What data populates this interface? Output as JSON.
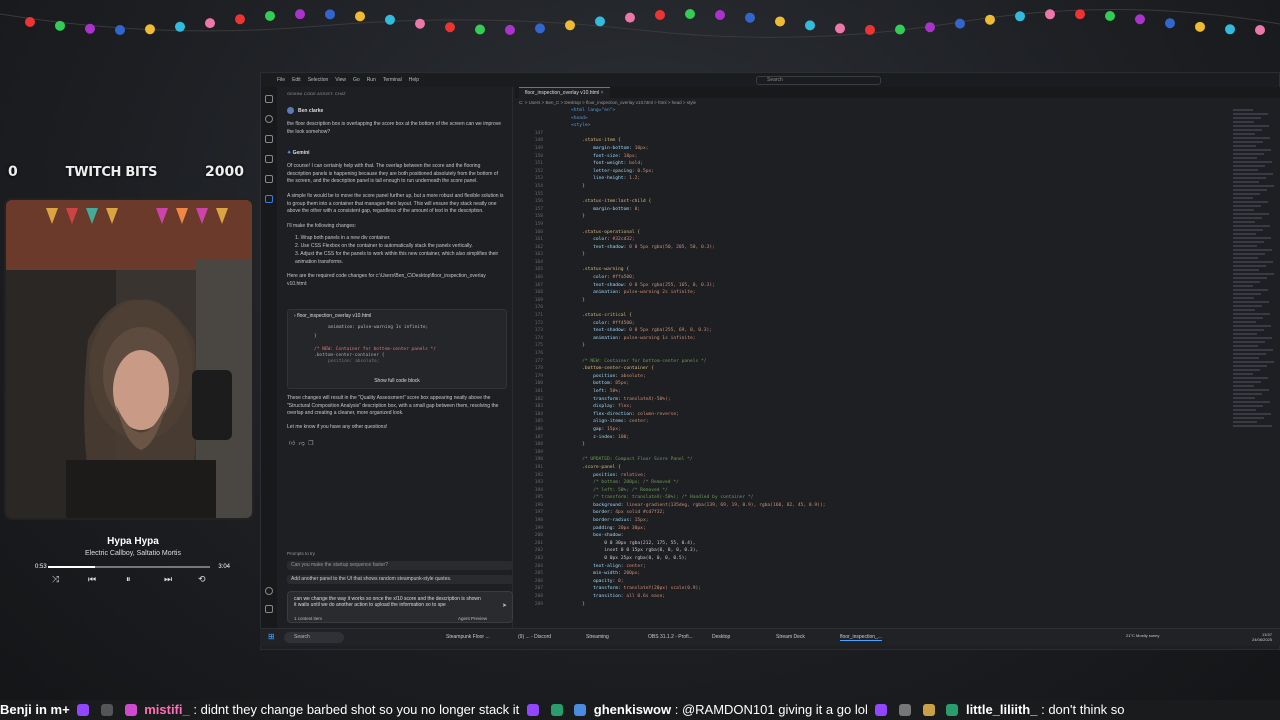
{
  "overlay": {
    "bits_left": "0",
    "bits_label": "TWITCH BITS",
    "bits_right": "2000"
  },
  "music": {
    "title": "Hypa Hypa",
    "artist": "Electric Callboy, Saltatio Mortis",
    "elapsed": "0:53",
    "duration": "3:04",
    "progress": 0.29
  },
  "menubar": {
    "items": [
      "File",
      "Edit",
      "Selection",
      "View",
      "Go",
      "Run",
      "Terminal",
      "Help"
    ],
    "search_placeholder": "Search"
  },
  "chat": {
    "header": "GEMINI CODE ASSIST: CHAT",
    "user_name": "Ben clarke",
    "user_message": "the floor description box is overlapping the score box at the bottom of the screen can we improve the look somehow?",
    "assistant_name": "Gemini",
    "p1": "Of course! I can certainly help with that. The overlap between the score and the flooring description panels is happening because they are both positioned absolutely from the bottom of the screen, and the description panel is tall enough to run underneath the score panel.",
    "p2": "A simple fix would be to move the score panel further up, but a more robust and flexible solution is to group them into a container that manages their layout. This will ensure they stack neatly one above the other with a consistent gap, regardless of the amount of text in the description.",
    "p3": "I'll make the following changes:",
    "steps": [
      "Wrap both panels in a new div container.",
      "Use CSS Flexbox on the container to automatically stack the panels vertically.",
      "Adjust the CSS for the panels to work within this new container, which also simplifies their animation transforms."
    ],
    "p4": "Here are the required code changes for c:\\Users\\Ben_C\\Desktop\\floor_inspection_overlay v10.html:",
    "code_file": "floor_inspection_overlay v10.html",
    "code_l1": "animation: pulse-warning 1s infinite;",
    "code_l2": "}",
    "code_l3": "/* NEW: Container for bottom-center panels */",
    "code_l4": ".bottom-center-container {",
    "code_l5": "position: absolute;",
    "show_full": "Show full code block",
    "p5": "These changes will result in the \"Quality Assessment\" score box appearing neatly above the \"Structural Composition Analysis\" description box, with a small gap between them, resolving the overlap and creating a cleaner, more organized look.",
    "p6": "Let me know if you have any other questions!",
    "prompts_label": "Prompts to try",
    "prompt1": "Can you make the startup sequence faster?",
    "prompt2": "Add another panel to the UI that shows random steampunk-style quotes.",
    "input_text": "can we change the way it works so once the x/10 score and the description is shown it waits until we do another action to upload the information so to spe",
    "context": "1 context item",
    "mode": "Agent   Preview"
  },
  "editor": {
    "tab": "floor_inspection_overlay v10.html",
    "breadcrumb": "C: > Users > Ben_C > Desktop > floor_inspection_overlay v10.html > html > head > style",
    "top_lines": [
      "<html lang=\"en\">",
      "<head>",
      "<style>"
    ],
    "lines": [
      {
        "n": "147",
        "t": ""
      },
      {
        "n": "148",
        "t": "    .status-item {"
      },
      {
        "n": "149",
        "t": "        margin-bottom: 10px;"
      },
      {
        "n": "150",
        "t": "        font-size: 18px;"
      },
      {
        "n": "151",
        "t": "        font-weight: bold;"
      },
      {
        "n": "152",
        "t": "        letter-spacing: 0.5px;"
      },
      {
        "n": "153",
        "t": "        line-height: 1.2;"
      },
      {
        "n": "154",
        "t": "    }"
      },
      {
        "n": "155",
        "t": ""
      },
      {
        "n": "156",
        "t": "    .status-item:last-child {"
      },
      {
        "n": "157",
        "t": "        margin-bottom: 0;"
      },
      {
        "n": "158",
        "t": "    }"
      },
      {
        "n": "159",
        "t": ""
      },
      {
        "n": "160",
        "t": "    .status-operational {"
      },
      {
        "n": "161",
        "t": "        color: #32cd32;"
      },
      {
        "n": "162",
        "t": "        text-shadow: 0 0 5px rgba(50, 205, 50, 0.3);"
      },
      {
        "n": "163",
        "t": "    }"
      },
      {
        "n": "164",
        "t": ""
      },
      {
        "n": "165",
        "t": "    .status-warning {"
      },
      {
        "n": "166",
        "t": "        color: #ffa500;"
      },
      {
        "n": "167",
        "t": "        text-shadow: 0 0 5px rgba(255, 165, 0, 0.3);"
      },
      {
        "n": "168",
        "t": "        animation: pulse-warning 2s infinite;"
      },
      {
        "n": "169",
        "t": "    }"
      },
      {
        "n": "170",
        "t": ""
      },
      {
        "n": "171",
        "t": "    .status-critical {"
      },
      {
        "n": "172",
        "t": "        color: #ff4500;"
      },
      {
        "n": "173",
        "t": "        text-shadow: 0 0 5px rgba(255, 69, 0, 0.3);"
      },
      {
        "n": "174",
        "t": "        animation: pulse-warning 1s infinite;"
      },
      {
        "n": "175",
        "t": "    }"
      },
      {
        "n": "176",
        "t": ""
      },
      {
        "n": "177",
        "t": "    /* NEW: Container for bottom-center panels */"
      },
      {
        "n": "178",
        "t": "    .bottom-center-container {"
      },
      {
        "n": "179",
        "t": "        position: absolute;"
      },
      {
        "n": "180",
        "t": "        bottom: 85px;"
      },
      {
        "n": "181",
        "t": "        left: 50%;"
      },
      {
        "n": "182",
        "t": "        transform: translateX(-50%);"
      },
      {
        "n": "183",
        "t": "        display: flex;"
      },
      {
        "n": "184",
        "t": "        flex-direction: column-reverse;"
      },
      {
        "n": "185",
        "t": "        align-items: center;"
      },
      {
        "n": "186",
        "t": "        gap: 15px;"
      },
      {
        "n": "187",
        "t": "        z-index: 100;"
      },
      {
        "n": "188",
        "t": "    }"
      },
      {
        "n": "189",
        "t": ""
      },
      {
        "n": "190",
        "t": "    /* UPDATED: Compact Floor Score Panel */"
      },
      {
        "n": "191",
        "t": "    .score-panel {"
      },
      {
        "n": "192",
        "t": "        position: relative;"
      },
      {
        "n": "193",
        "t": "        /* bottom: 200px; /* Removed */"
      },
      {
        "n": "194",
        "t": "        /* left: 50%; /* Removed */"
      },
      {
        "n": "195",
        "t": "        /* transform: translateX(-50%); /* Handled by container */"
      },
      {
        "n": "196",
        "t": "        background: linear-gradient(135deg, rgba(139, 69, 19, 0.9), rgba(160, 82, 45, 0.9));"
      },
      {
        "n": "197",
        "t": "        border: 4px solid #cd7f32;"
      },
      {
        "n": "198",
        "t": "        border-radius: 15px;"
      },
      {
        "n": "199",
        "t": "        padding: 20px 30px;"
      },
      {
        "n": "200",
        "t": "        box-shadow:"
      },
      {
        "n": "201",
        "t": "            0 0 30px rgba(212, 175, 55, 0.4),"
      },
      {
        "n": "202",
        "t": "            inset 0 0 15px rgba(0, 0, 0, 0.3),"
      },
      {
        "n": "203",
        "t": "            0 0px 25px rgba(0, 0, 0, 0.5);"
      },
      {
        "n": "204",
        "t": "        text-align: center;"
      },
      {
        "n": "205",
        "t": "        min-width: 200px;"
      },
      {
        "n": "206",
        "t": "        opacity: 0;"
      },
      {
        "n": "207",
        "t": "        transform: translateY(20px) scale(0.9);"
      },
      {
        "n": "208",
        "t": "        transition: all 0.6s ease;"
      },
      {
        "n": "209",
        "t": "    }"
      }
    ]
  },
  "statusbar": {
    "right": "Ln 177, Col 1   Spaces: 4   UTF-8   CRLF   {} HTML"
  },
  "taskbar": {
    "search": "Search",
    "items": [
      "Steampunk Floor ...",
      "(9) ... - Discord",
      "Streaming",
      "OBS 31.1.2 - Profi...",
      "Desktop",
      "Stream Deck",
      "floor_inspection_..."
    ],
    "weather": "21°C Mostly sunny",
    "time": "13:57",
    "date": "24/08/2025"
  },
  "ticker": [
    {
      "name": "Benji in m+",
      "msg": ""
    },
    {
      "name": "mistifi_",
      "msg": ": didnt they change barbed shot so you no longer stack it"
    },
    {
      "name": "ghenkiswow",
      "msg": ": @RAMDON101 giving it a go lol"
    },
    {
      "name": "little_liliith_",
      "msg": ": don't think so"
    }
  ],
  "colors": {
    "accent": "#3d7be0",
    "twitch": "#9146ff"
  }
}
